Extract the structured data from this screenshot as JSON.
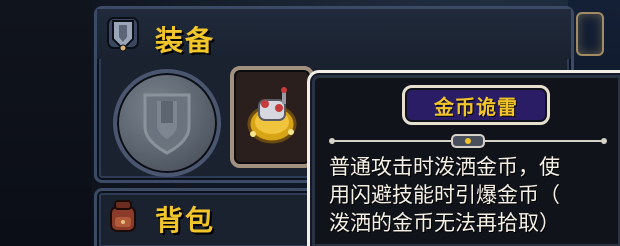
{
  "equipment_panel": {
    "title": "装备",
    "header_icon": "shield-banner-icon",
    "slots": [
      {
        "state": "empty",
        "icon": "shield-silhouette-icon"
      },
      {
        "state": "equipped",
        "icon": "gold-coin-mine-icon"
      }
    ]
  },
  "bag_panel": {
    "title": "背包",
    "header_icon": "backpack-icon"
  },
  "tooltip": {
    "title": "金币诡雷",
    "description_lines": [
      "普通攻击时泼洒金币，使",
      "用闪避技能时引爆金币（",
      "泼洒的金币无法再拾取）"
    ]
  },
  "colors": {
    "title_gold": "#f2c52b",
    "panel_bg": "#1a2230",
    "panel_border": "#3b4a65",
    "tooltip_bg": "#10131a",
    "tooltip_border": "#f2efe6",
    "title_plate": "#2a1d66",
    "text": "#f6f1e6"
  }
}
